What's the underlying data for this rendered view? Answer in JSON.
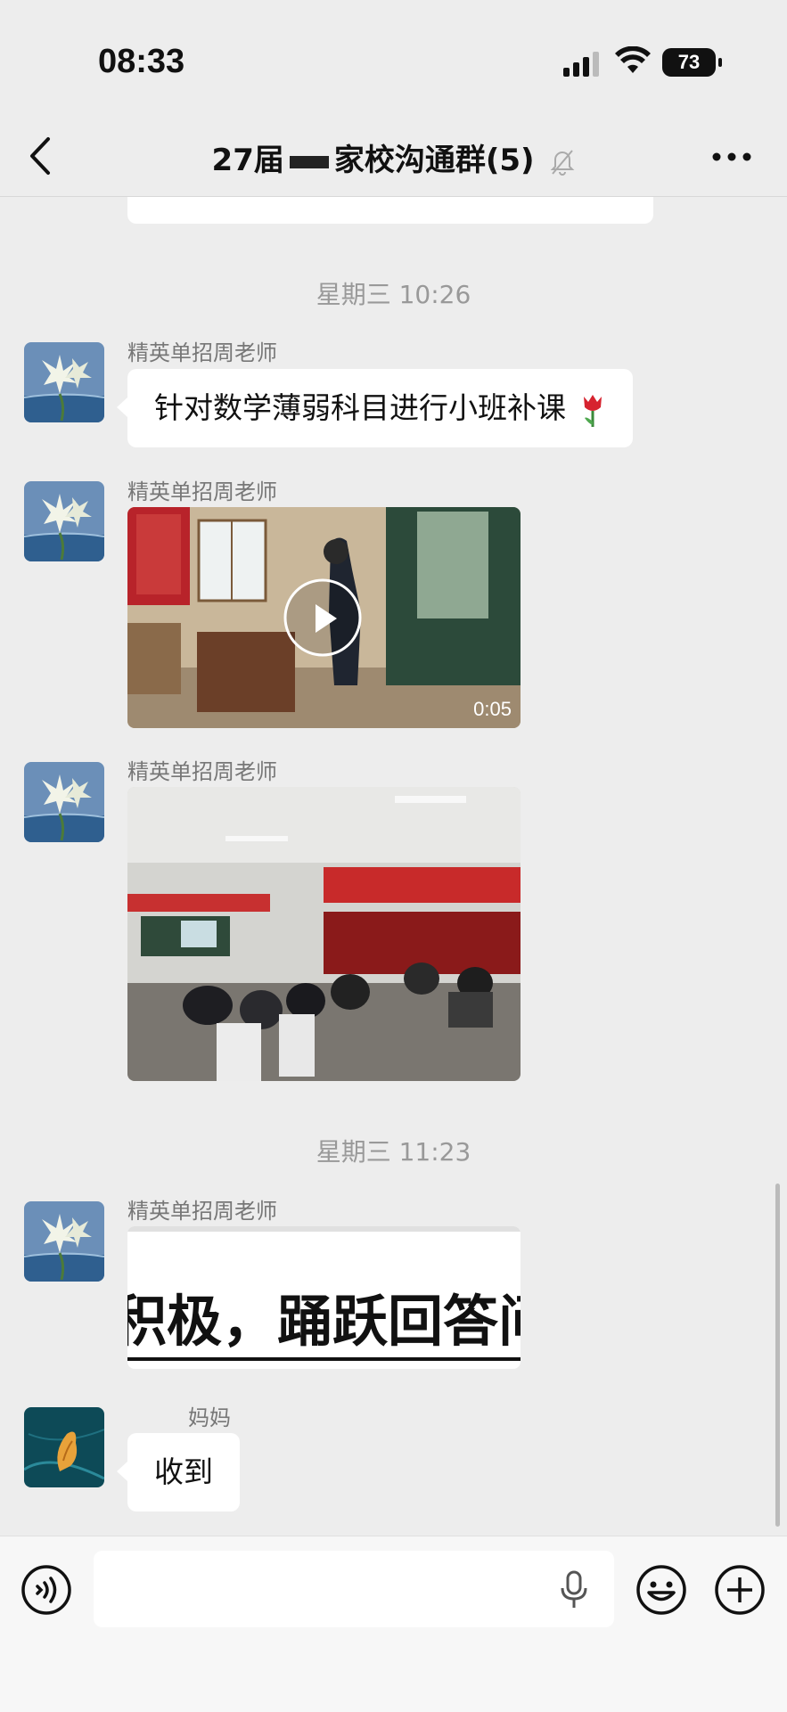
{
  "status_bar": {
    "time": "08:33",
    "battery": "73"
  },
  "header": {
    "title_prefix": "27届",
    "title_suffix": "家校沟通群(5)"
  },
  "messages": [
    {
      "type": "timestamp",
      "text": "星期三 10:26"
    },
    {
      "sender": "精英单招周老师",
      "text": "针对数学薄弱科目进行小班补课"
    },
    {
      "sender": "精英单招周老师",
      "type": "video",
      "duration": "0:05"
    },
    {
      "sender": "精英单招周老师",
      "type": "image"
    },
    {
      "type": "timestamp",
      "text": "星期三 11:23"
    },
    {
      "sender": "精英单招周老师",
      "type": "image_text",
      "image_text": "积极，踊跃回答问"
    },
    {
      "sender": "妈妈",
      "text": "收到"
    }
  ],
  "icons": [
    "back-icon",
    "mute-bell-icon",
    "more-icon",
    "voice-icon",
    "mic-icon",
    "emoji-icon",
    "plus-icon",
    "play-icon"
  ]
}
